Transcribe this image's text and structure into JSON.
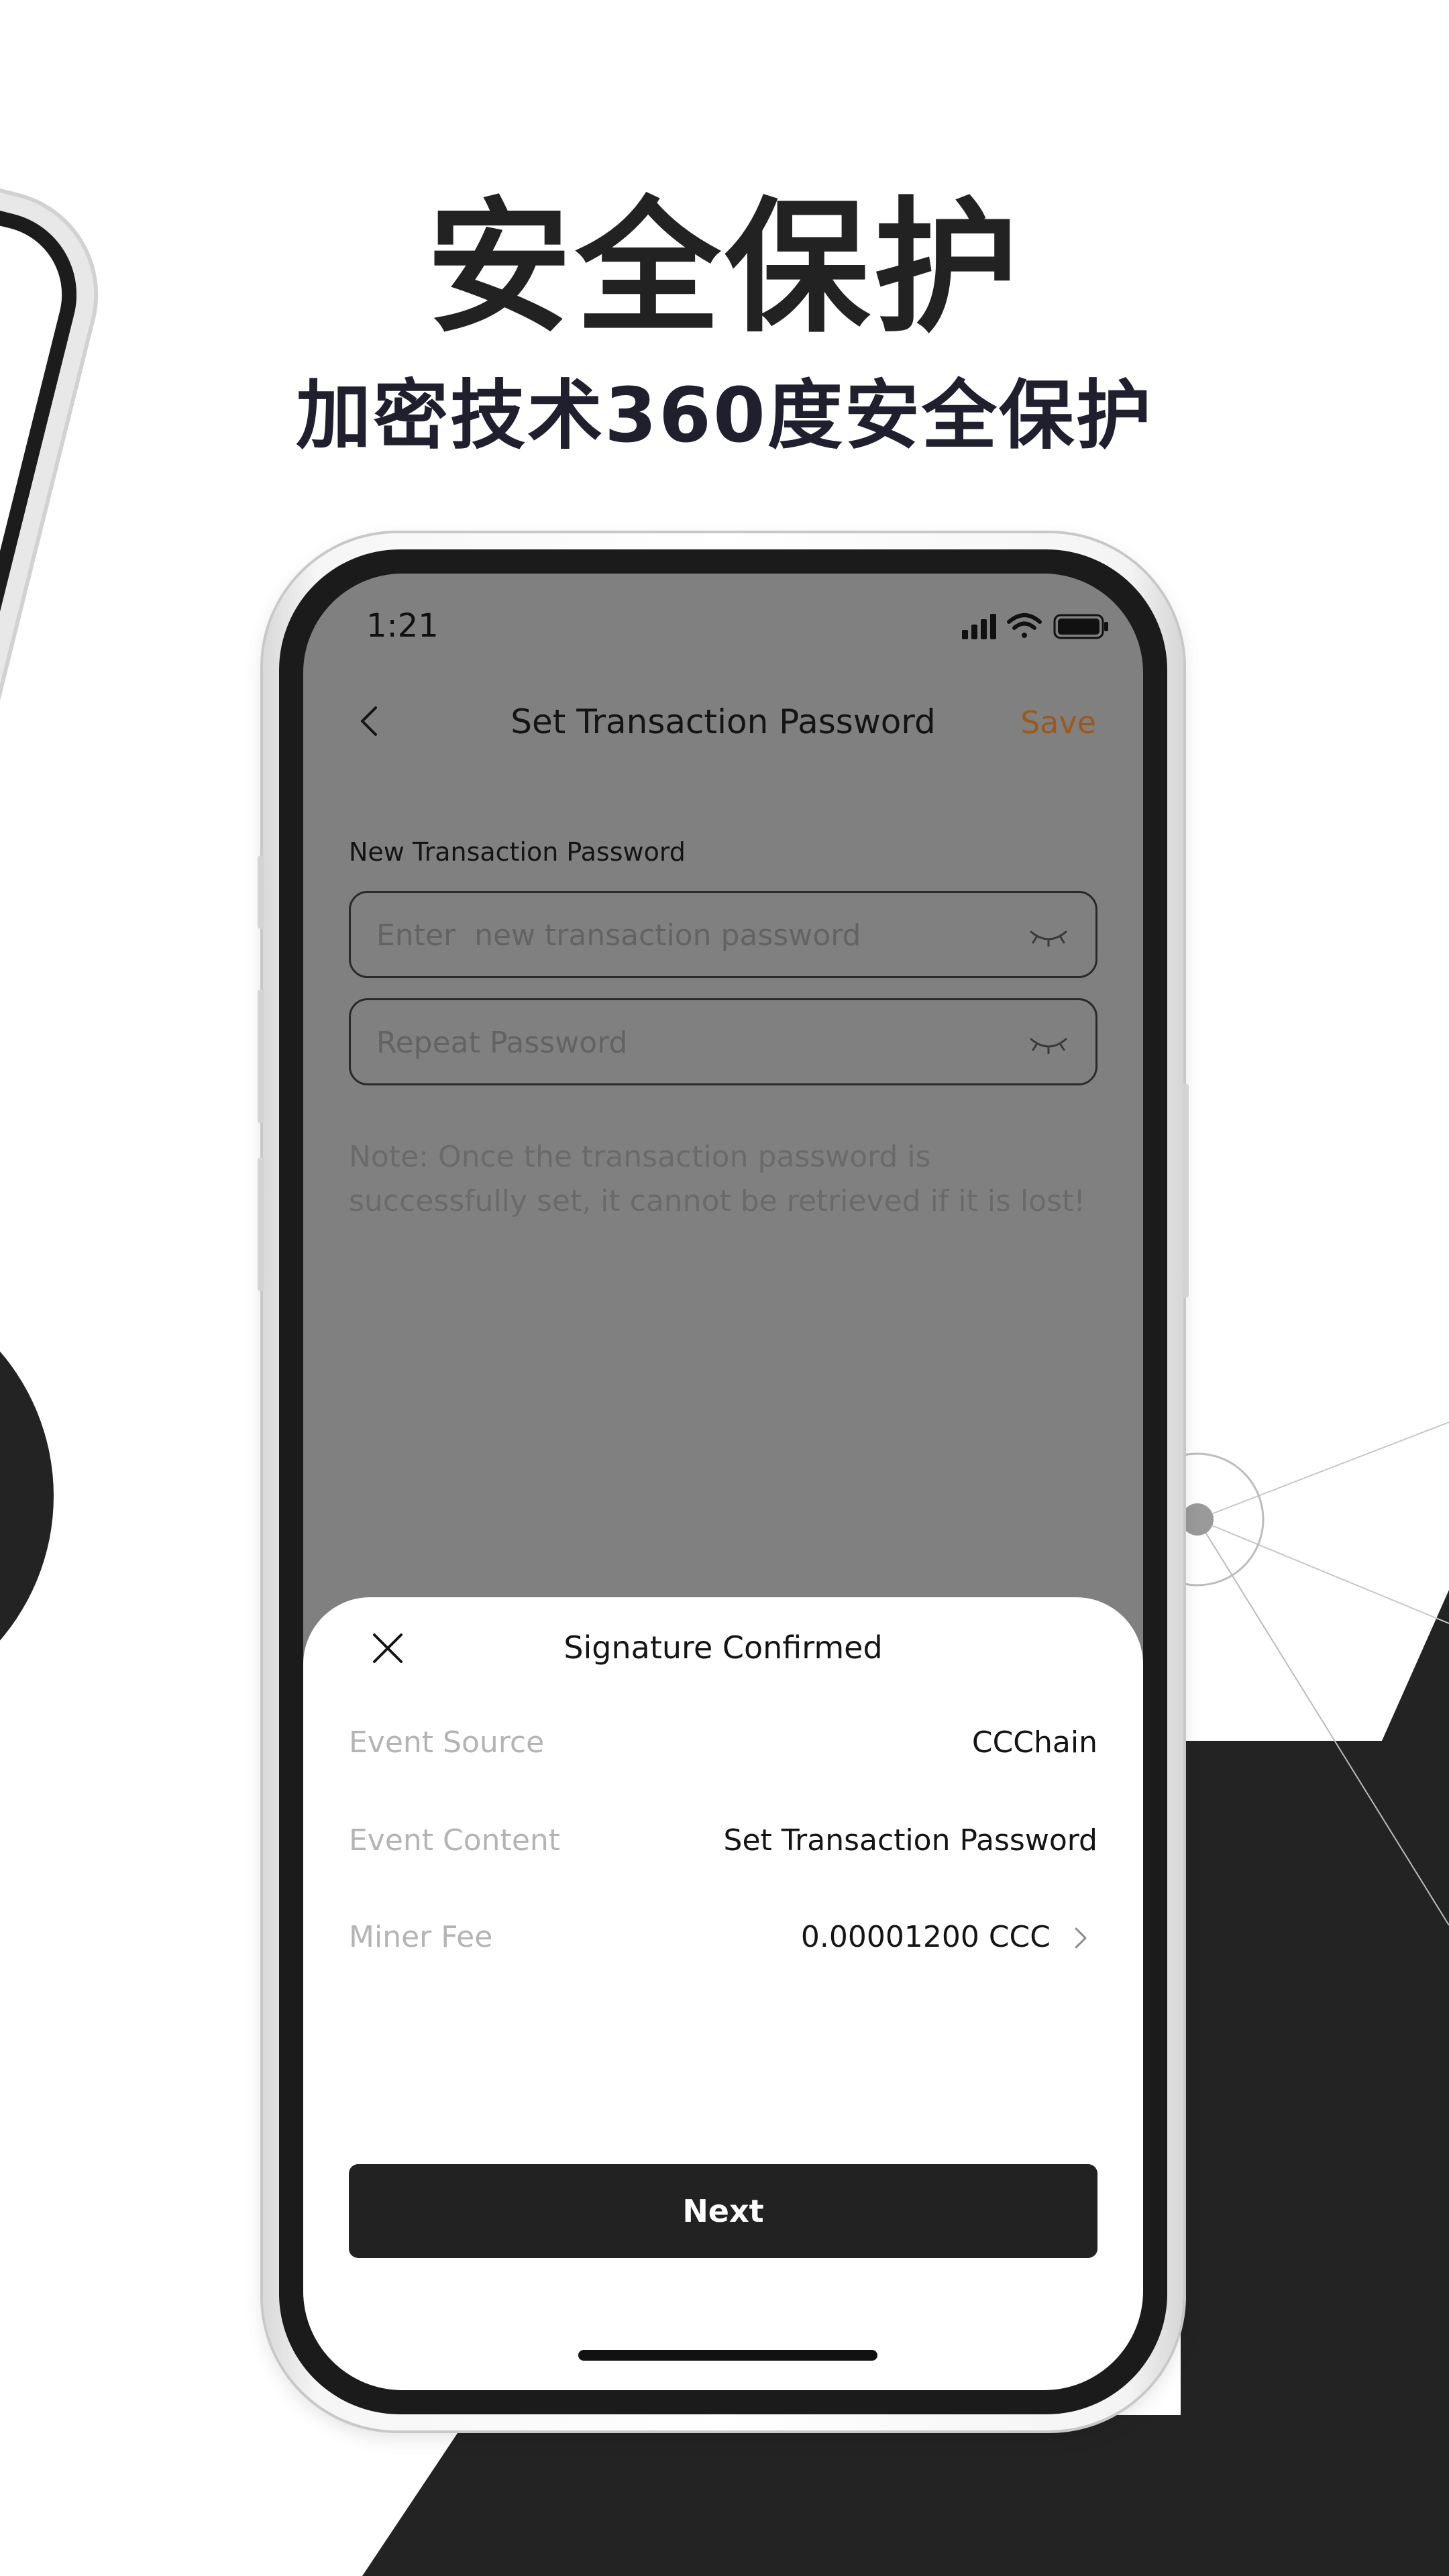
{
  "promo": {
    "headline": "安全保护",
    "subheadline": "加密技术360度安全保护"
  },
  "status_bar": {
    "time": "1:21",
    "icons": [
      "signal-icon",
      "wifi-icon",
      "battery-icon"
    ]
  },
  "nav": {
    "back_icon": "chevron-left-icon",
    "title": "Set Transaction Password",
    "save_label": "Save"
  },
  "form": {
    "label": "New Transaction Password",
    "new_password_placeholder": "Enter  new transaction password",
    "repeat_password_placeholder": "Repeat Password",
    "eye_icon": "eye-closed-icon",
    "note": "Note: Once the transaction password is successfully set, it cannot be retrieved if it is lost!"
  },
  "sheet": {
    "close_icon": "close-icon",
    "title": "Signature Confirmed",
    "rows": [
      {
        "label": "Event Source",
        "value": "CCChain"
      },
      {
        "label": "Event Content",
        "value": "Set Transaction Password"
      },
      {
        "label": "Miner Fee",
        "value": "0.00001200 CCC"
      }
    ],
    "next_label": "Next"
  },
  "colors": {
    "accent_save": "#9a5a1e",
    "button_bg": "#222222",
    "overlay": "#808080"
  }
}
